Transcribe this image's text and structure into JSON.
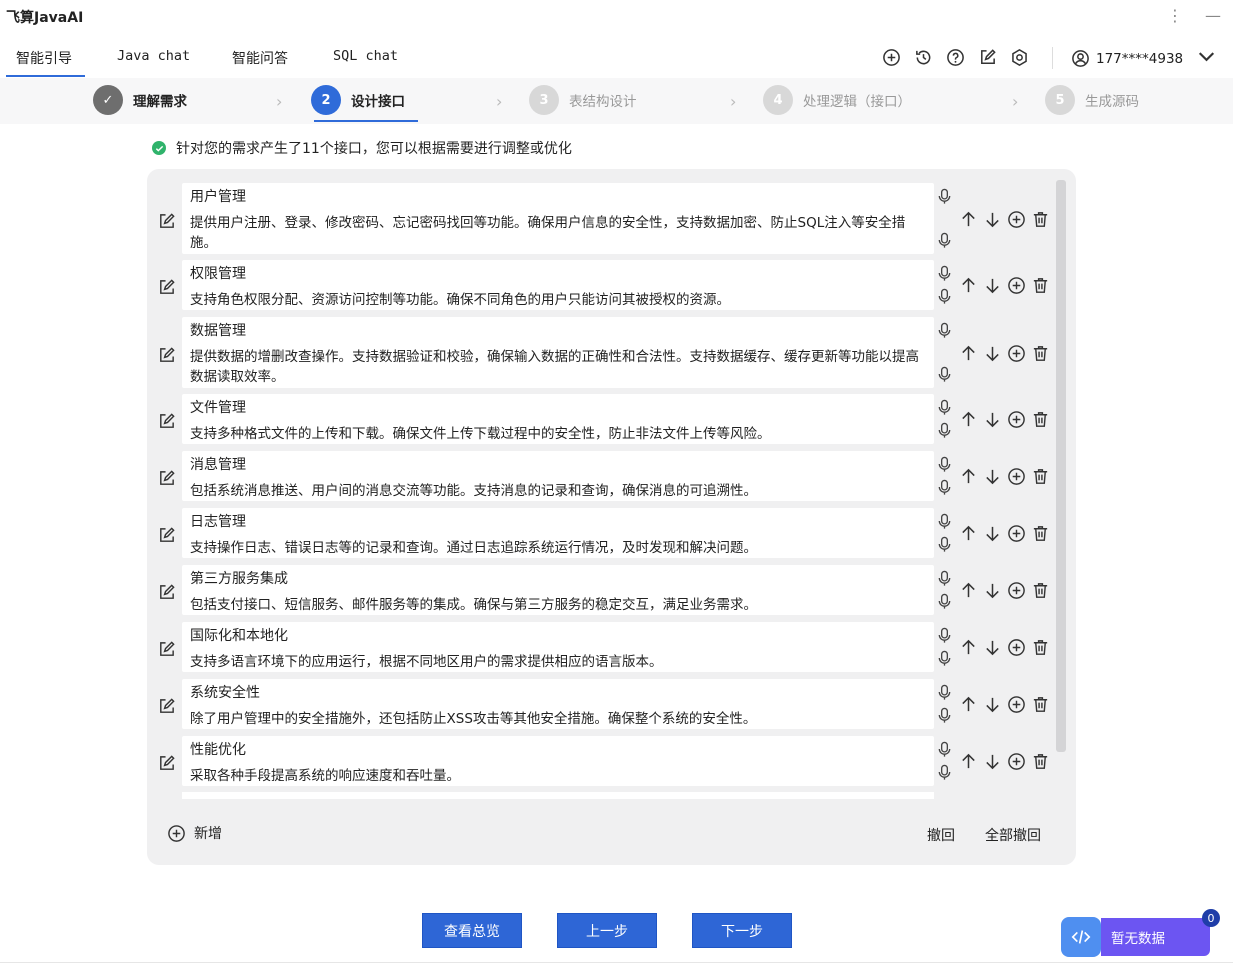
{
  "app": {
    "title": "飞算JavaAI"
  },
  "tabs": [
    {
      "label": "智能引导",
      "active": true
    },
    {
      "label": "Java chat"
    },
    {
      "label": "智能问答"
    },
    {
      "label": "SQL chat"
    }
  ],
  "toolbar_icons": [
    "plus-circle-icon",
    "history-icon",
    "help-icon",
    "edit-icon",
    "settings-icon"
  ],
  "user": {
    "phone": "177****4938"
  },
  "steps": [
    {
      "num": "✓",
      "label": "理解需求",
      "state": "done"
    },
    {
      "num": "2",
      "label": "设计接口",
      "state": "active"
    },
    {
      "num": "3",
      "label": "表结构设计",
      "state": "todo"
    },
    {
      "num": "4",
      "label": "处理逻辑（接口）",
      "state": "todo"
    },
    {
      "num": "5",
      "label": "生成源码",
      "state": "todo"
    }
  ],
  "notice": "针对您的需求产生了11个接口，您可以根据需要进行调整或优化",
  "interfaces": [
    {
      "name": "用户管理",
      "desc": "提供用户注册、登录、修改密码、忘记密码找回等功能。确保用户信息的安全性，支持数据加密、防止SQL注入等安全措施。"
    },
    {
      "name": "权限管理",
      "desc": "支持角色权限分配、资源访问控制等功能。确保不同角色的用户只能访问其被授权的资源。"
    },
    {
      "name": "数据管理",
      "desc": "提供数据的增删改查操作。支持数据验证和校验，确保输入数据的正确性和合法性。支持数据缓存、缓存更新等功能以提高数据读取效率。"
    },
    {
      "name": "文件管理",
      "desc": "支持多种格式文件的上传和下载。确保文件上传下载过程中的安全性，防止非法文件上传等风险。"
    },
    {
      "name": "消息管理",
      "desc": "包括系统消息推送、用户间的消息交流等功能。支持消息的记录和查询，确保消息的可追溯性。"
    },
    {
      "name": "日志管理",
      "desc": "支持操作日志、错误日志等的记录和查询。通过日志追踪系统运行情况，及时发现和解决问题。"
    },
    {
      "name": "第三方服务集成",
      "desc": "包括支付接口、短信服务、邮件服务等的集成。确保与第三方服务的稳定交互，满足业务需求。"
    },
    {
      "name": "国际化和本地化",
      "desc": "支持多语言环境下的应用运行，根据不同地区用户的需求提供相应的语言版本。"
    },
    {
      "name": "系统安全性",
      "desc": "除了用户管理中的安全措施外，还包括防止XSS攻击等其他安全措施。确保整个系统的安全性。"
    },
    {
      "name": "性能优化",
      "desc": "采取各种手段提高系统的响应速度和吞吐量。"
    }
  ],
  "panel_footer": {
    "add": "新增",
    "undo": "撤回",
    "undo_all": "全部撤回"
  },
  "buttons": {
    "overview": "查看总览",
    "prev": "上一步",
    "next": "下一步"
  },
  "widget": {
    "label": "暂无数据",
    "badge": "0"
  }
}
